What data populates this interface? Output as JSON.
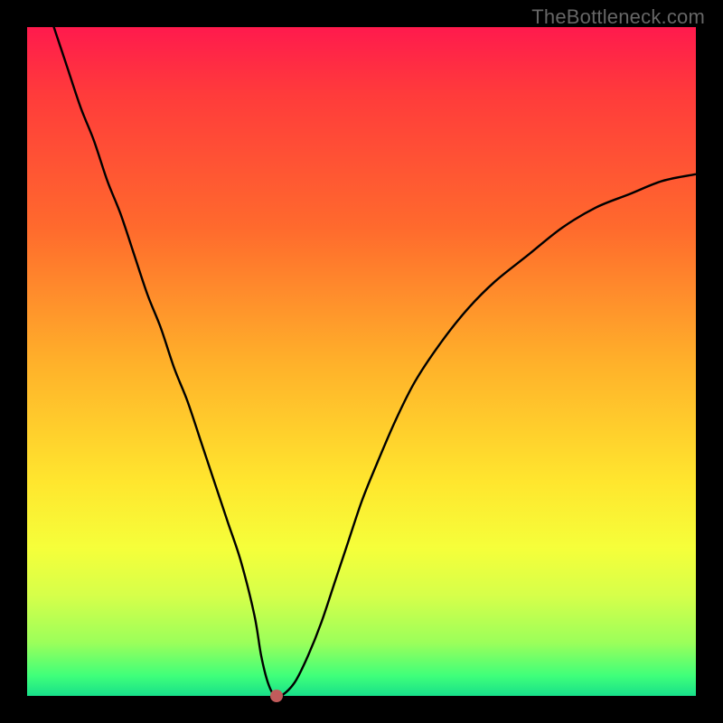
{
  "watermark_text": "TheBottleneck.com",
  "chart_data": {
    "type": "line",
    "title": "",
    "xlabel": "",
    "ylabel": "",
    "xlim": [
      0,
      100
    ],
    "ylim": [
      0,
      100
    ],
    "series": [
      {
        "name": "curve",
        "x": [
          4,
          6,
          8,
          10,
          12,
          14,
          16,
          18,
          20,
          22,
          24,
          26,
          28,
          30,
          32,
          34,
          35,
          36,
          37,
          38,
          40,
          42,
          44,
          46,
          48,
          50,
          52,
          55,
          58,
          62,
          66,
          70,
          75,
          80,
          85,
          90,
          95,
          100
        ],
        "y": [
          100,
          94,
          88,
          83,
          77,
          72,
          66,
          60,
          55,
          49,
          44,
          38,
          32,
          26,
          20,
          12,
          6,
          2,
          0,
          0,
          2,
          6,
          11,
          17,
          23,
          29,
          34,
          41,
          47,
          53,
          58,
          62,
          66,
          70,
          73,
          75,
          77,
          78
        ]
      }
    ],
    "marker": {
      "x": 37.3,
      "y": 0,
      "color": "#c25b5b",
      "radius": 7
    },
    "gradient_stops": [
      {
        "pos": 0,
        "color": "#ff1a4d"
      },
      {
        "pos": 10,
        "color": "#ff3b3b"
      },
      {
        "pos": 30,
        "color": "#ff6a2d"
      },
      {
        "pos": 50,
        "color": "#ffb02a"
      },
      {
        "pos": 68,
        "color": "#ffe62e"
      },
      {
        "pos": 78,
        "color": "#f5ff3a"
      },
      {
        "pos": 85,
        "color": "#d6ff4a"
      },
      {
        "pos": 92,
        "color": "#9cff5a"
      },
      {
        "pos": 97,
        "color": "#3fff7a"
      },
      {
        "pos": 100,
        "color": "#18e08a"
      }
    ]
  }
}
